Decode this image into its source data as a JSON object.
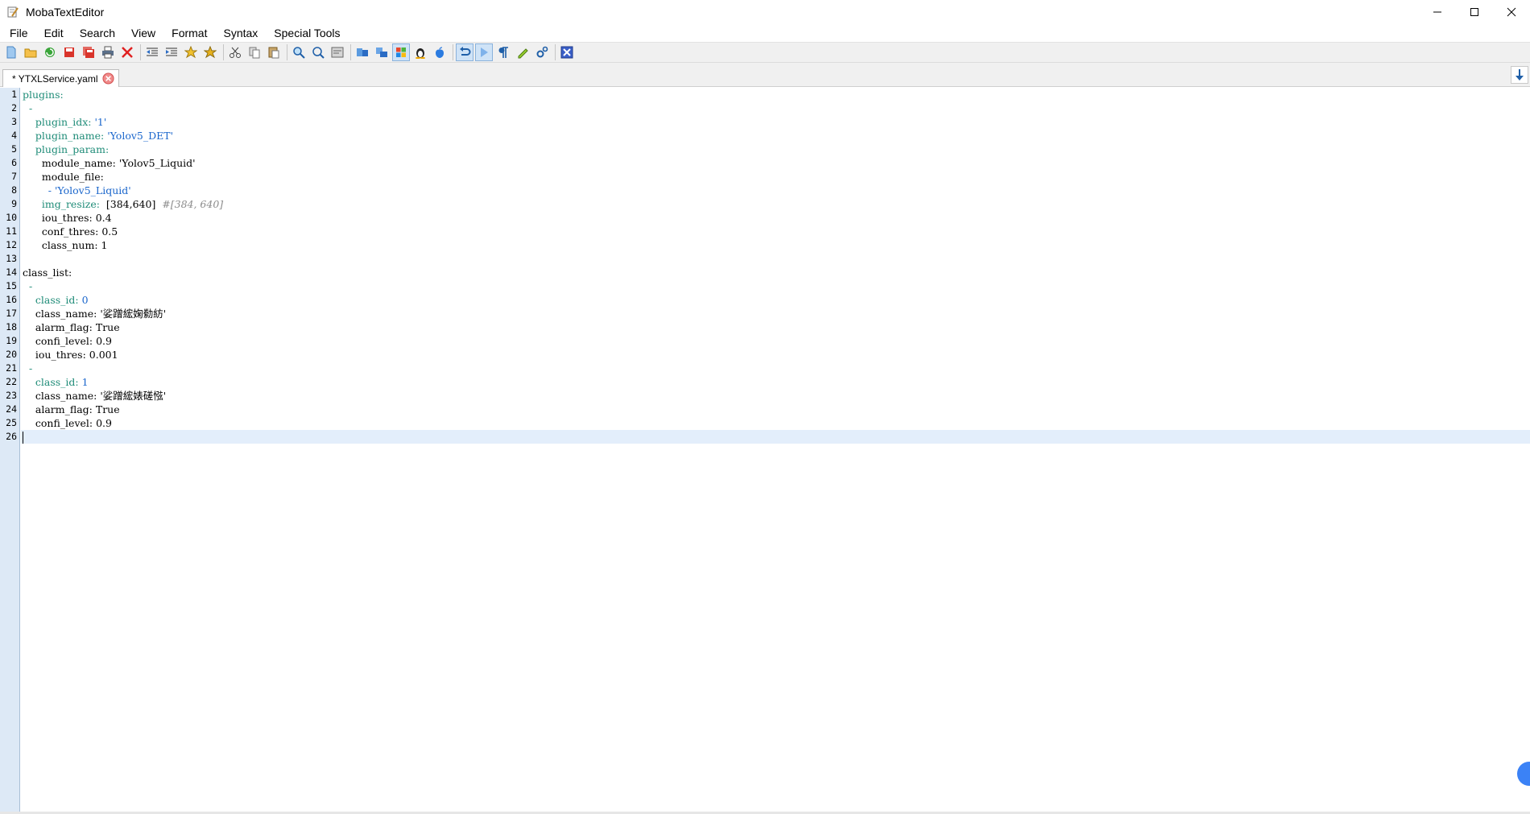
{
  "window": {
    "title": "MobaTextEditor"
  },
  "menu": [
    "File",
    "Edit",
    "Search",
    "View",
    "Format",
    "Syntax",
    "Special Tools"
  ],
  "toolbar": {
    "icons": [
      "new-file-icon",
      "open-folder-icon",
      "reload-icon",
      "save-icon",
      "save-all-icon",
      "print-icon",
      "close-red-x-icon",
      "unindent-icon",
      "indent-icon",
      "bookmark-icon",
      "bookmark-next-icon",
      "cut-icon",
      "copy-icon",
      "paste-icon",
      "find-icon",
      "replace-icon",
      "goto-icon",
      "compare-icon",
      "sync-icon",
      "windows-eol-icon",
      "linux-eol-icon",
      "mac-eol-icon",
      "undo-icon",
      "redo-icon",
      "pilcrow-icon",
      "highlight-pen-icon",
      "settings-icon",
      "exit-icon"
    ]
  },
  "tab": {
    "label": "* YTXLService.yaml"
  },
  "editor": {
    "lines": [
      "1",
      "2",
      "3",
      "4",
      "5",
      "6",
      "7",
      "8",
      "9",
      "10",
      "11",
      "12",
      "13",
      "14",
      "15",
      "16",
      "17",
      "18",
      "19",
      "20",
      "21",
      "22",
      "23",
      "24",
      "25",
      "26"
    ],
    "code": {
      "l1": "plugins:",
      "l2": "  -",
      "l3_key": "    plugin_idx:",
      "l3_val": " '1'",
      "l4_key": "    plugin_name:",
      "l4_val": " 'Yolov5_DET'",
      "l5_key": "    plugin_param:",
      "l6": "      module_name: 'Yolov5_Liquid'",
      "l7": "      module_file:",
      "l8": "        - 'Yolov5_Liquid'",
      "l9_key": "      img_resize:",
      "l9_val": "  [384,640]  ",
      "l9_comment": "#[384, 640]",
      "l10": "      iou_thres: 0.4",
      "l11": "      conf_thres: 0.5",
      "l12": "      class_num: 1",
      "l13": "",
      "l14": "class_list:",
      "l15": "  -",
      "l16_key": "    class_id:",
      "l16_val": " 0",
      "l17": "    class_name: '娑蹭綋婅勬紡'",
      "l18": "    alarm_flag: True",
      "l19": "    confi_level: 0.9",
      "l20": "    iou_thres: 0.001",
      "l21": "  -",
      "l22_key": "    class_id:",
      "l22_val": " 1",
      "l23": "    class_name: '娑蹭綋婊磋惤'",
      "l24": "    alarm_flag: True",
      "l25": "    confi_level: 0.9",
      "l26": ""
    }
  }
}
